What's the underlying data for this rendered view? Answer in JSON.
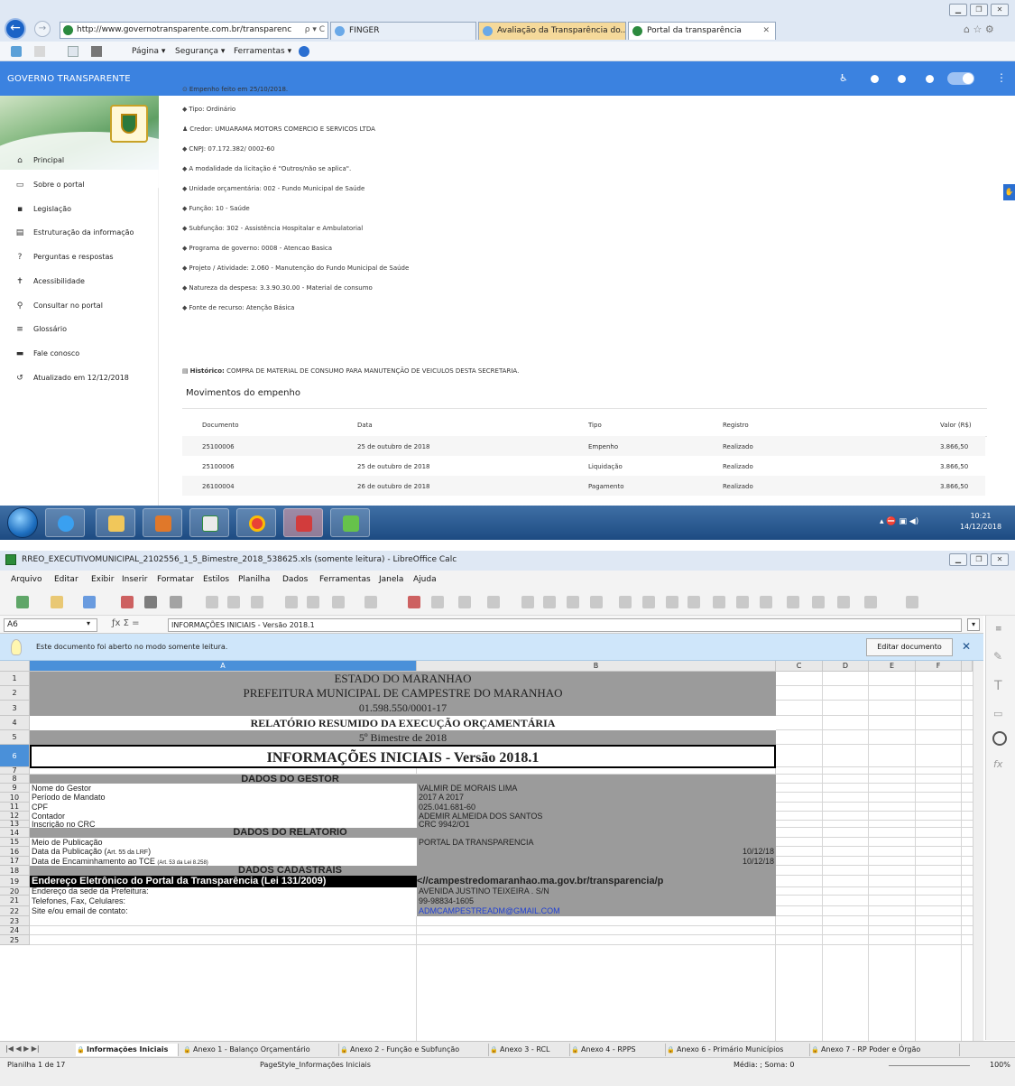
{
  "ie": {
    "url": "http://www.governotransparente.com.br/transparenc",
    "url_controls": "ρ ▾ C",
    "tabs": [
      {
        "label": "FINGER"
      },
      {
        "label": "Avaliação da Transparência do..."
      },
      {
        "label": "Portal da transparência"
      }
    ],
    "command_bar": {
      "page": "Página ▾",
      "security": "Segurança ▾",
      "tools": "Ferramentas ▾"
    }
  },
  "portal": {
    "header_title": "GOVERNO TRANSPARENTE",
    "sidebar": [
      {
        "icon": "home-icon",
        "glyph": "⌂",
        "label": "Principal"
      },
      {
        "icon": "folder-icon",
        "glyph": "▭",
        "label": "Sobre o portal"
      },
      {
        "icon": "file-icon",
        "glyph": "▪",
        "label": "Legislação"
      },
      {
        "icon": "structure-icon",
        "glyph": "▤",
        "label": "Estruturação da informação"
      },
      {
        "icon": "question-icon",
        "glyph": "?",
        "label": "Perguntas e respostas"
      },
      {
        "icon": "accessibility-icon",
        "glyph": "✝",
        "label": "Acessibilidade"
      },
      {
        "icon": "search-icon",
        "glyph": "⚲",
        "label": "Consultar no portal"
      },
      {
        "icon": "list-icon",
        "glyph": "≡",
        "label": "Glossário"
      },
      {
        "icon": "chat-icon",
        "glyph": "▬",
        "label": "Fale conosco"
      },
      {
        "icon": "history-icon",
        "glyph": "↺",
        "label": "Atualizado em 12/12/2018"
      }
    ],
    "details": [
      {
        "icon": "⊙",
        "text": "Empenho feito em 25/10/2018."
      },
      {
        "icon": "◆",
        "text": "Tipo: Ordinário"
      },
      {
        "icon": "♟",
        "text": "Credor: UMUARAMA MOTORS COMERCIO E SERVICOS LTDA"
      },
      {
        "icon": "◆",
        "text": "CNPJ: 07.172.382/ 0002-60"
      },
      {
        "icon": "◆",
        "text": "A modalidade da licitação é \"Outros/não se aplica\"."
      },
      {
        "icon": "◆",
        "text": "Unidade orçamentária: 002 - Fundo Municipal de Saúde"
      },
      {
        "icon": "◆",
        "text": "Função: 10 - Saúde"
      },
      {
        "icon": "◆",
        "text": "Subfunção: 302 - Assistência Hospitalar e Ambulatorial"
      },
      {
        "icon": "◆",
        "text": "Programa de governo: 0008 - Atencao Basica"
      },
      {
        "icon": "◆",
        "text": "Projeto / Atividade: 2.060 - Manutenção do Fundo Municipal de Saúde"
      },
      {
        "icon": "◆",
        "text": "Natureza da despesa: 3.3.90.30.00 - Material de consumo"
      },
      {
        "icon": "◆",
        "text": "Fonte de recurso: Atenção Básica"
      }
    ],
    "historico_label": "Histórico:",
    "historico_text": "COMPRA DE MATERIAL DE CONSUMO PARA MANUTENÇÃO DE VEICULOS DESTA SECRETARIA.",
    "movimentos_title": "Movimentos do empenho",
    "table_headers": [
      "Documento",
      "Data",
      "Tipo",
      "Registro",
      "Valor (R$)"
    ],
    "table_rows": [
      [
        "25100006",
        "25 de outubro de 2018",
        "Empenho",
        "Realizado",
        "3.866,50"
      ],
      [
        "25100006",
        "25 de outubro de 2018",
        "Liquidação",
        "Realizado",
        "3.866,50"
      ],
      [
        "26100004",
        "26 de outubro de 2018",
        "Pagamento",
        "Realizado",
        "3.866,50"
      ]
    ]
  },
  "taskbar": {
    "time": "10:21",
    "date": "14/12/2018"
  },
  "calc": {
    "title": "RREO_EXECUTIVOMUNICIPAL_2102556_1_5_Bimestre_2018_538625.xls (somente leitura) - LibreOffice Calc",
    "menus": [
      "Arquivo",
      "Editar",
      "Exibir",
      "Inserir",
      "Formatar",
      "Estilos",
      "Planilha",
      "Dados",
      "Ferramentas",
      "Janela",
      "Ajuda"
    ],
    "namebox": "A6",
    "formula": "INFORMAÇÕES INICIAIS - Versão 2018.1",
    "info_message": "Este documento foi aberto no modo somente leitura.",
    "edit_button": "Editar documento",
    "columns": [
      "A",
      "B",
      "C",
      "D",
      "E",
      "F"
    ],
    "rows": [
      "1",
      "2",
      "3",
      "4",
      "5",
      "6",
      "7",
      "8",
      "9",
      "10",
      "11",
      "12",
      "13",
      "14",
      "15",
      "16",
      "17",
      "18",
      "19",
      "20",
      "21",
      "22",
      "23",
      "24",
      "25"
    ],
    "cells": {
      "r1": "ESTADO DO MARANHAO",
      "r2": "PREFEITURA MUNICIPAL DE CAMPESTRE DO MARANHAO",
      "r3": "01.598.550/0001-17",
      "r4": "RELATÓRIO RESUMIDO DA EXECUÇÃO ORÇAMENTÁRIA",
      "r5": "5º Bimestre de 2018",
      "r6": "INFORMAÇÕES INICIAIS - Versão 2018.1",
      "r8": "DADOS DO GESTOR",
      "r9a": "Nome do Gestor",
      "r9b": "VALMIR DE MORAIS LIMA",
      "r10a": "Período de Mandato",
      "r10b": "2017 A 2017",
      "r11a": "CPF",
      "r11b": "025.041.681-60",
      "r12a": "Contador",
      "r12b": "ADEMIR ALMEIDA DOS SANTOS",
      "r13a": "Inscrição no CRC",
      "r13b": "CRC 9942/O1",
      "r14": "DADOS DO RELATÓRIO",
      "r15a": "Meio de Publicação",
      "r15b": "PORTAL DA TRANSPARENCIA",
      "r16a": "Data da Publicação (",
      "r16a_small": "Art. 55 da LRF",
      "r16a_end": ")",
      "r16b": "10/12/18",
      "r17a": "Data de Encaminhamento ao TCE ",
      "r17a_small": "(Art. 53 da Lei 8.258)",
      "r17b": "10/12/18",
      "r18": "DADOS CADASTRAIS",
      "r19a": "Endereço Eletrônico do Portal da Transparência (Lei 131/2009)",
      "r19b": "<//campestredomaranhao.ma.gov.br/transparencia/p",
      "r20a": "Endereço da sede da Prefeitura:",
      "r20b": "AVENIDA JUSTINO TEIXEIRA . S/N",
      "r21a": "Telefones, Fax, Celulares:",
      "r21b": "99-98834-1605",
      "r22a": "Site e/ou email de contato:",
      "r22b": "ADMCAMPESTREADM@GMAIL.COM"
    },
    "sheet_tabs": [
      "Informações Iniciais",
      "Anexo 1 - Balanço Orçamentário",
      "Anexo 2 - Função e Subfunção",
      "Anexo 3 - RCL",
      "Anexo 4 - RPPS",
      "Anexo 6 - Primário Municípios",
      "Anexo 7 - RP Poder e Órgão"
    ],
    "status": {
      "sheet": "Planilha 1 de 17",
      "style": "PageStyle_Informações Iniciais",
      "sum": "Média: ; Soma: 0",
      "zoom": "100%"
    }
  }
}
